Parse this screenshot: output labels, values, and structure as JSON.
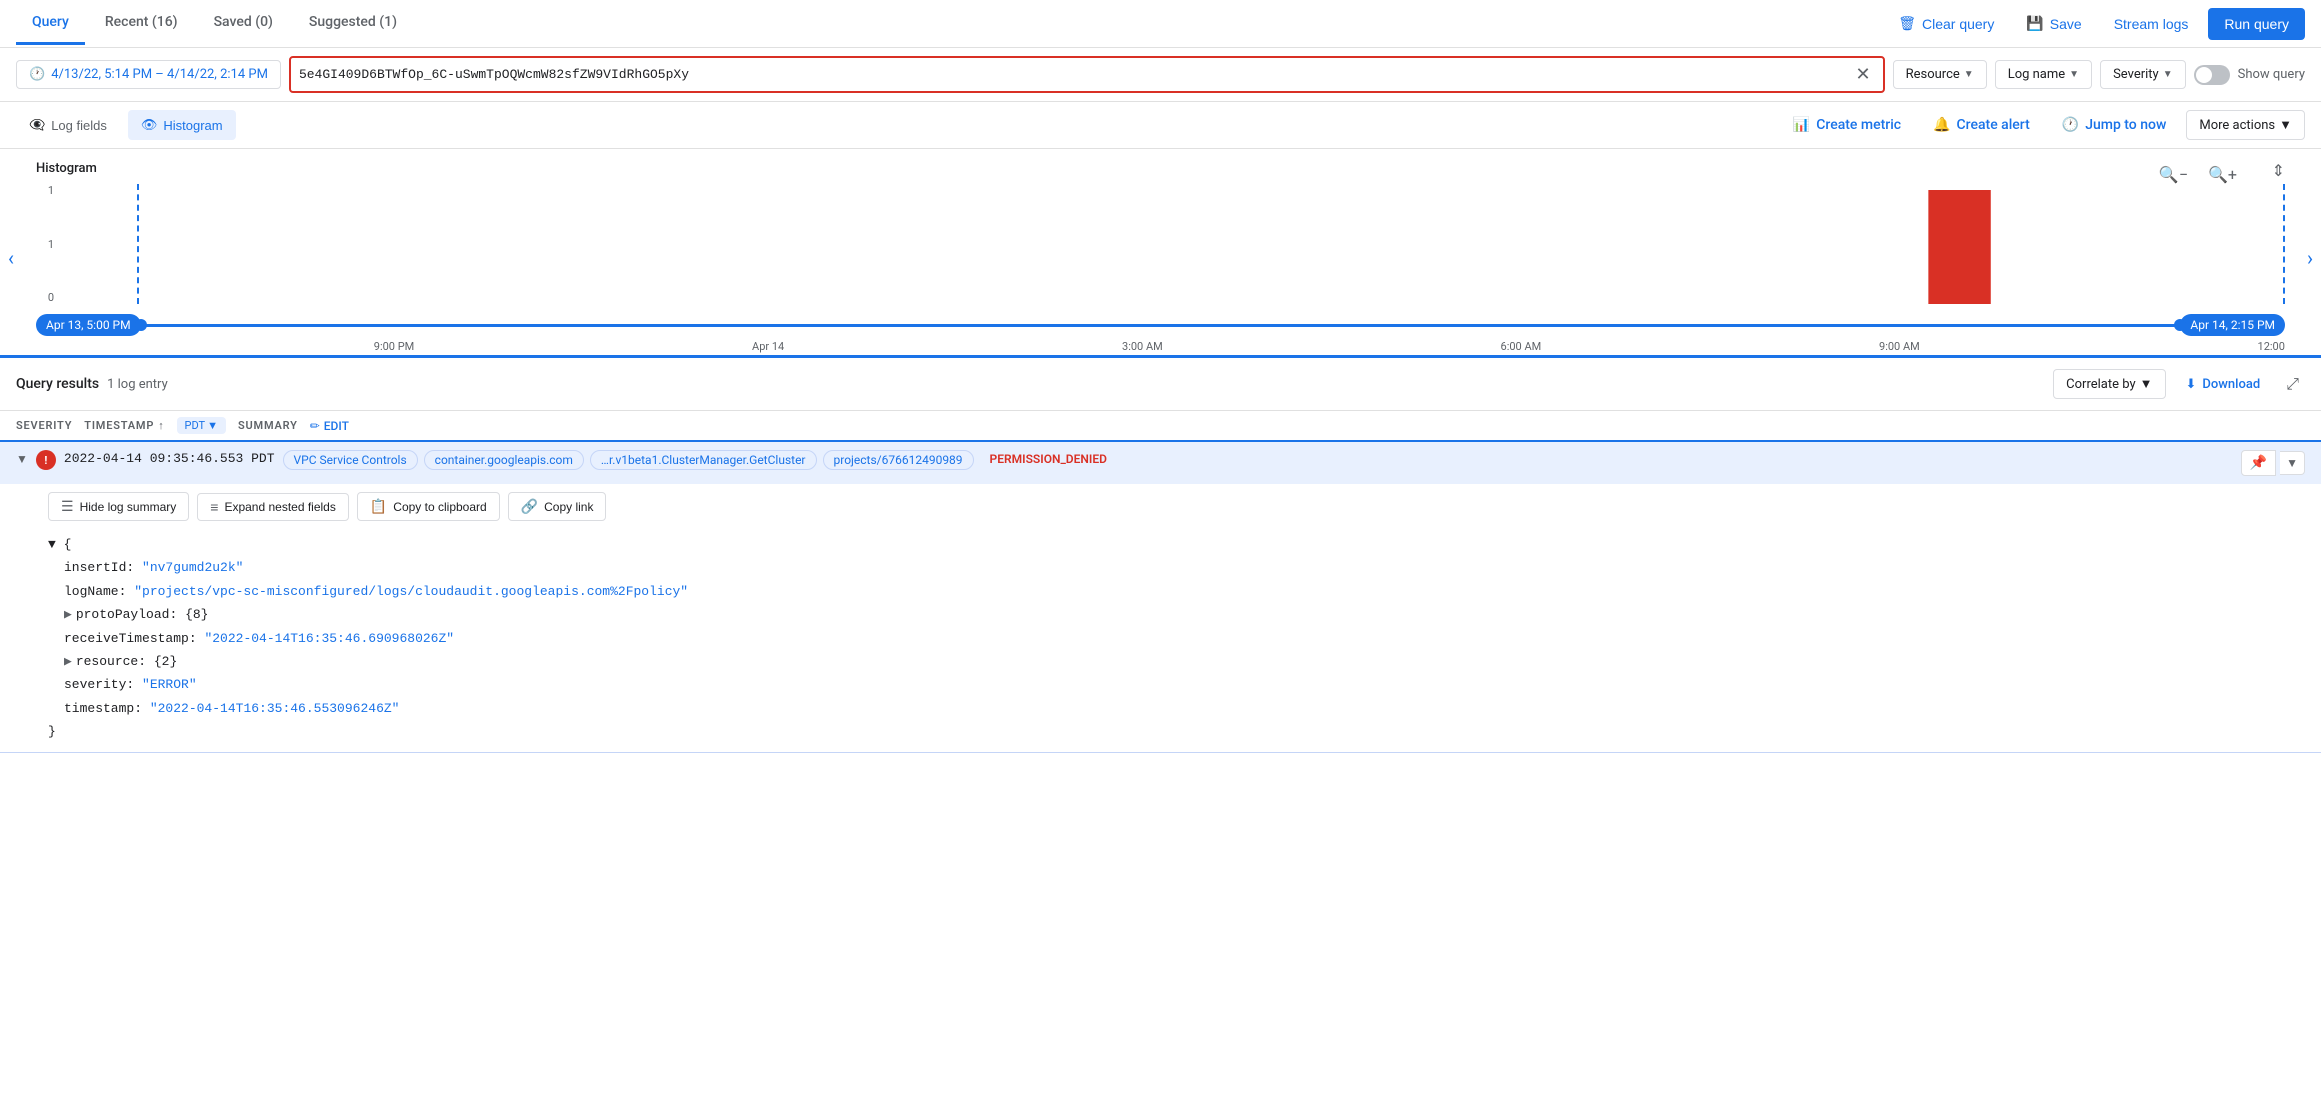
{
  "tabs": {
    "items": [
      {
        "label": "Query",
        "active": true
      },
      {
        "label": "Recent (16)",
        "active": false
      },
      {
        "label": "Saved (0)",
        "active": false
      },
      {
        "label": "Suggested (1)",
        "active": false
      }
    ],
    "actions": {
      "clear_query": "Clear query",
      "save": "Save",
      "stream_logs": "Stream logs",
      "run_query": "Run query"
    }
  },
  "search": {
    "time_range": "4/13/22, 5:14 PM – 4/14/22, 2:14 PM",
    "query": "5e4GI409D6BTWfOp_6C-uSwmTpOQWcmW82sfZW9VIdRhGO5pXy",
    "filters": {
      "resource": "Resource",
      "log_name": "Log name",
      "severity": "Severity"
    },
    "show_query": "Show query"
  },
  "toolbar": {
    "log_fields": "Log fields",
    "histogram": "Histogram",
    "create_metric": "Create metric",
    "create_alert": "Create alert",
    "jump_to_now": "Jump to now",
    "more_actions": "More actions"
  },
  "histogram": {
    "title": "Histogram",
    "y_labels": [
      "1",
      "1",
      "0"
    ],
    "time_labels": [
      "Apr 13, 5:00 PM",
      "9:00 PM",
      "Apr 14",
      "3:00 AM",
      "6:00 AM",
      "9:00 AM",
      "12:00"
    ],
    "range_start": "Apr 13, 5:00 PM",
    "range_end": "Apr 14, 2:15 PM",
    "bar_data": [
      0,
      0,
      0,
      0,
      0,
      0,
      0,
      0,
      0,
      0,
      0,
      0,
      0,
      0,
      0,
      0,
      0,
      0,
      0,
      0,
      1,
      0
    ]
  },
  "results": {
    "title": "Query results",
    "count": "1 log entry",
    "correlate_by": "Correlate by",
    "download": "Download",
    "columns": {
      "severity": "SEVERITY",
      "timestamp": "TIMESTAMP",
      "tz": "PDT",
      "summary": "SUMMARY",
      "edit": "EDIT"
    },
    "entry": {
      "timestamp": "2022-04-14 09:35:46.553 PDT",
      "tags": [
        "VPC Service Controls",
        "container.googleapis.com",
        "…r.v1beta1.ClusterManager.GetCluster",
        "projects/676612490989"
      ],
      "error_label": "PERMISSION_DENIED",
      "detail_toolbar": {
        "hide_log_summary": "Hide log summary",
        "expand_nested": "Expand nested fields",
        "copy_clipboard": "Copy to clipboard",
        "copy_link": "Copy link"
      },
      "json": {
        "insertId_key": "insertId",
        "insertId_val": "\"nv7gumd2u2k\"",
        "logName_key": "logName",
        "logName_val": "\"projects/vpc-sc-misconfigured/logs/cloudaudit.googleapis.com%2Fpolicy\"",
        "protoPayload_key": "protoPayload",
        "protoPayload_val": "{8}",
        "receiveTimestamp_key": "receiveTimestamp",
        "receiveTimestamp_val": "\"2022-04-14T16:35:46.690968026Z\"",
        "resource_key": "resource",
        "resource_val": "{2}",
        "severity_key": "severity",
        "severity_val": "\"ERROR\"",
        "timestamp_key": "timestamp",
        "timestamp_val": "\"2022-04-14T16:35:46.553096246Z\""
      }
    }
  }
}
